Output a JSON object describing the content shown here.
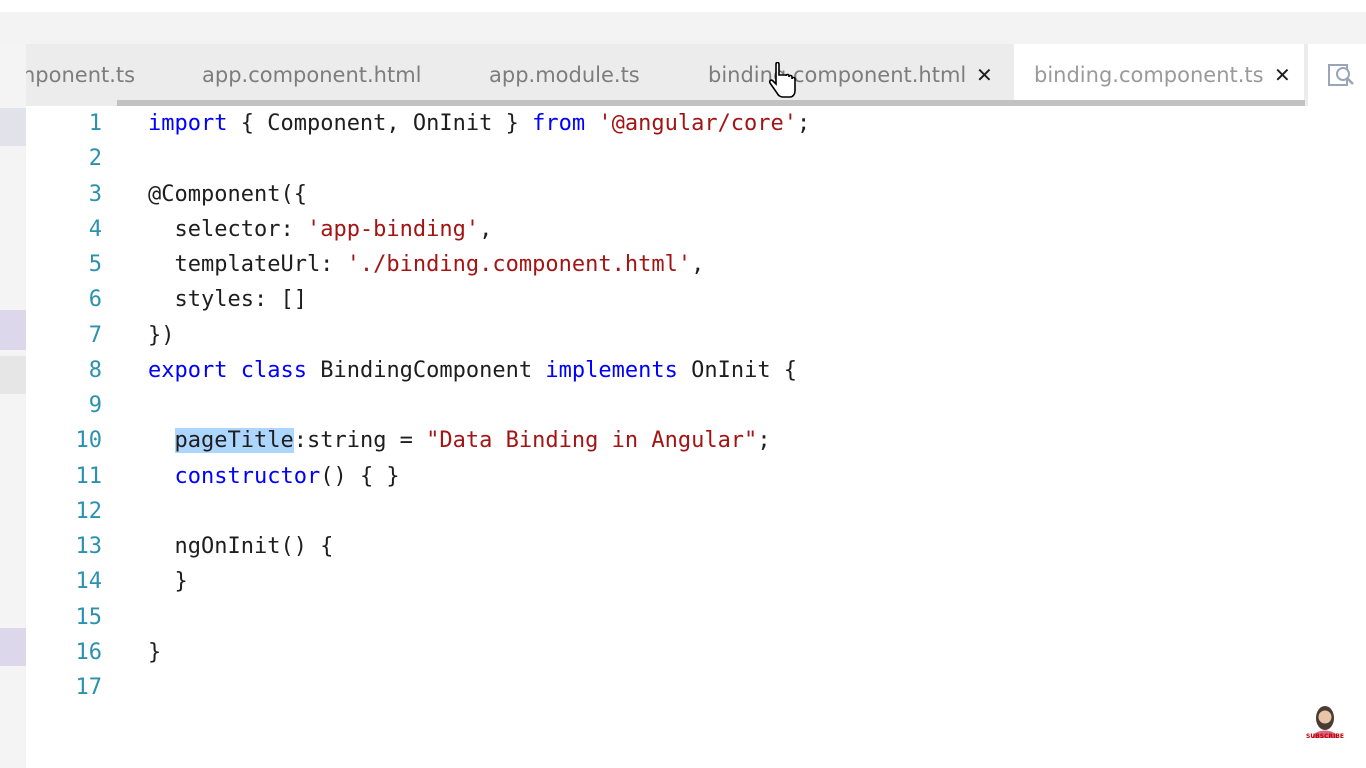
{
  "tabs": [
    {
      "label": "nponent.ts",
      "active": false,
      "closable": false
    },
    {
      "label": "app.component.html",
      "active": false,
      "closable": false
    },
    {
      "label": "app.module.ts",
      "active": false,
      "closable": false
    },
    {
      "label": "binding.component.html",
      "active": false,
      "closable": true
    },
    {
      "label": "binding.component.ts",
      "active": true,
      "closable": true
    }
  ],
  "tab_close_glyph": "✕",
  "code_lines": [
    {
      "n": "1",
      "tokens": [
        [
          "kw",
          "import"
        ],
        [
          "p",
          " { Component, OnInit } "
        ],
        [
          "kw",
          "from"
        ],
        [
          "p",
          " "
        ],
        [
          "str",
          "'@angular/core'"
        ],
        [
          "p",
          ";"
        ]
      ]
    },
    {
      "n": "2",
      "tokens": []
    },
    {
      "n": "3",
      "tokens": [
        [
          "p",
          "@Component({"
        ]
      ]
    },
    {
      "n": "4",
      "tokens": [
        [
          "p",
          "  selector: "
        ],
        [
          "str",
          "'app-binding'"
        ],
        [
          "p",
          ","
        ]
      ]
    },
    {
      "n": "5",
      "tokens": [
        [
          "p",
          "  templateUrl: "
        ],
        [
          "str",
          "'./binding.component.html'"
        ],
        [
          "p",
          ","
        ]
      ]
    },
    {
      "n": "6",
      "tokens": [
        [
          "p",
          "  styles: []"
        ]
      ]
    },
    {
      "n": "7",
      "tokens": [
        [
          "p",
          "})"
        ]
      ]
    },
    {
      "n": "8",
      "tokens": [
        [
          "kw",
          "export"
        ],
        [
          "p",
          " "
        ],
        [
          "kw",
          "class"
        ],
        [
          "p",
          " BindingComponent "
        ],
        [
          "kw",
          "implements"
        ],
        [
          "p",
          " OnInit {"
        ]
      ]
    },
    {
      "n": "9",
      "tokens": []
    },
    {
      "n": "10",
      "tokens": [
        [
          "p",
          "  "
        ],
        [
          "sel",
          "pageTitle"
        ],
        [
          "p",
          ":string = "
        ],
        [
          "str",
          "\"Data Binding in Angular\""
        ],
        [
          "p",
          ";"
        ]
      ]
    },
    {
      "n": "11",
      "tokens": [
        [
          "p",
          "  "
        ],
        [
          "kw",
          "constructor"
        ],
        [
          "p",
          "() { }"
        ]
      ]
    },
    {
      "n": "12",
      "tokens": []
    },
    {
      "n": "13",
      "tokens": [
        [
          "p",
          "  ngOnInit() {"
        ]
      ]
    },
    {
      "n": "14",
      "tokens": [
        [
          "p",
          "  }"
        ]
      ]
    },
    {
      "n": "15",
      "tokens": []
    },
    {
      "n": "16",
      "tokens": [
        [
          "p",
          "}"
        ]
      ]
    },
    {
      "n": "17",
      "tokens": []
    }
  ],
  "avatar_label": "SUBSCRIBE",
  "colors": {
    "keyword": "#0000ff",
    "string": "#a31515",
    "line_number": "#2b91af",
    "selection": "#add6ff",
    "tab_bar": "#ececec"
  },
  "icons": [
    "close-icon",
    "find-icon",
    "hand-cursor-icon",
    "avatar-icon"
  ]
}
